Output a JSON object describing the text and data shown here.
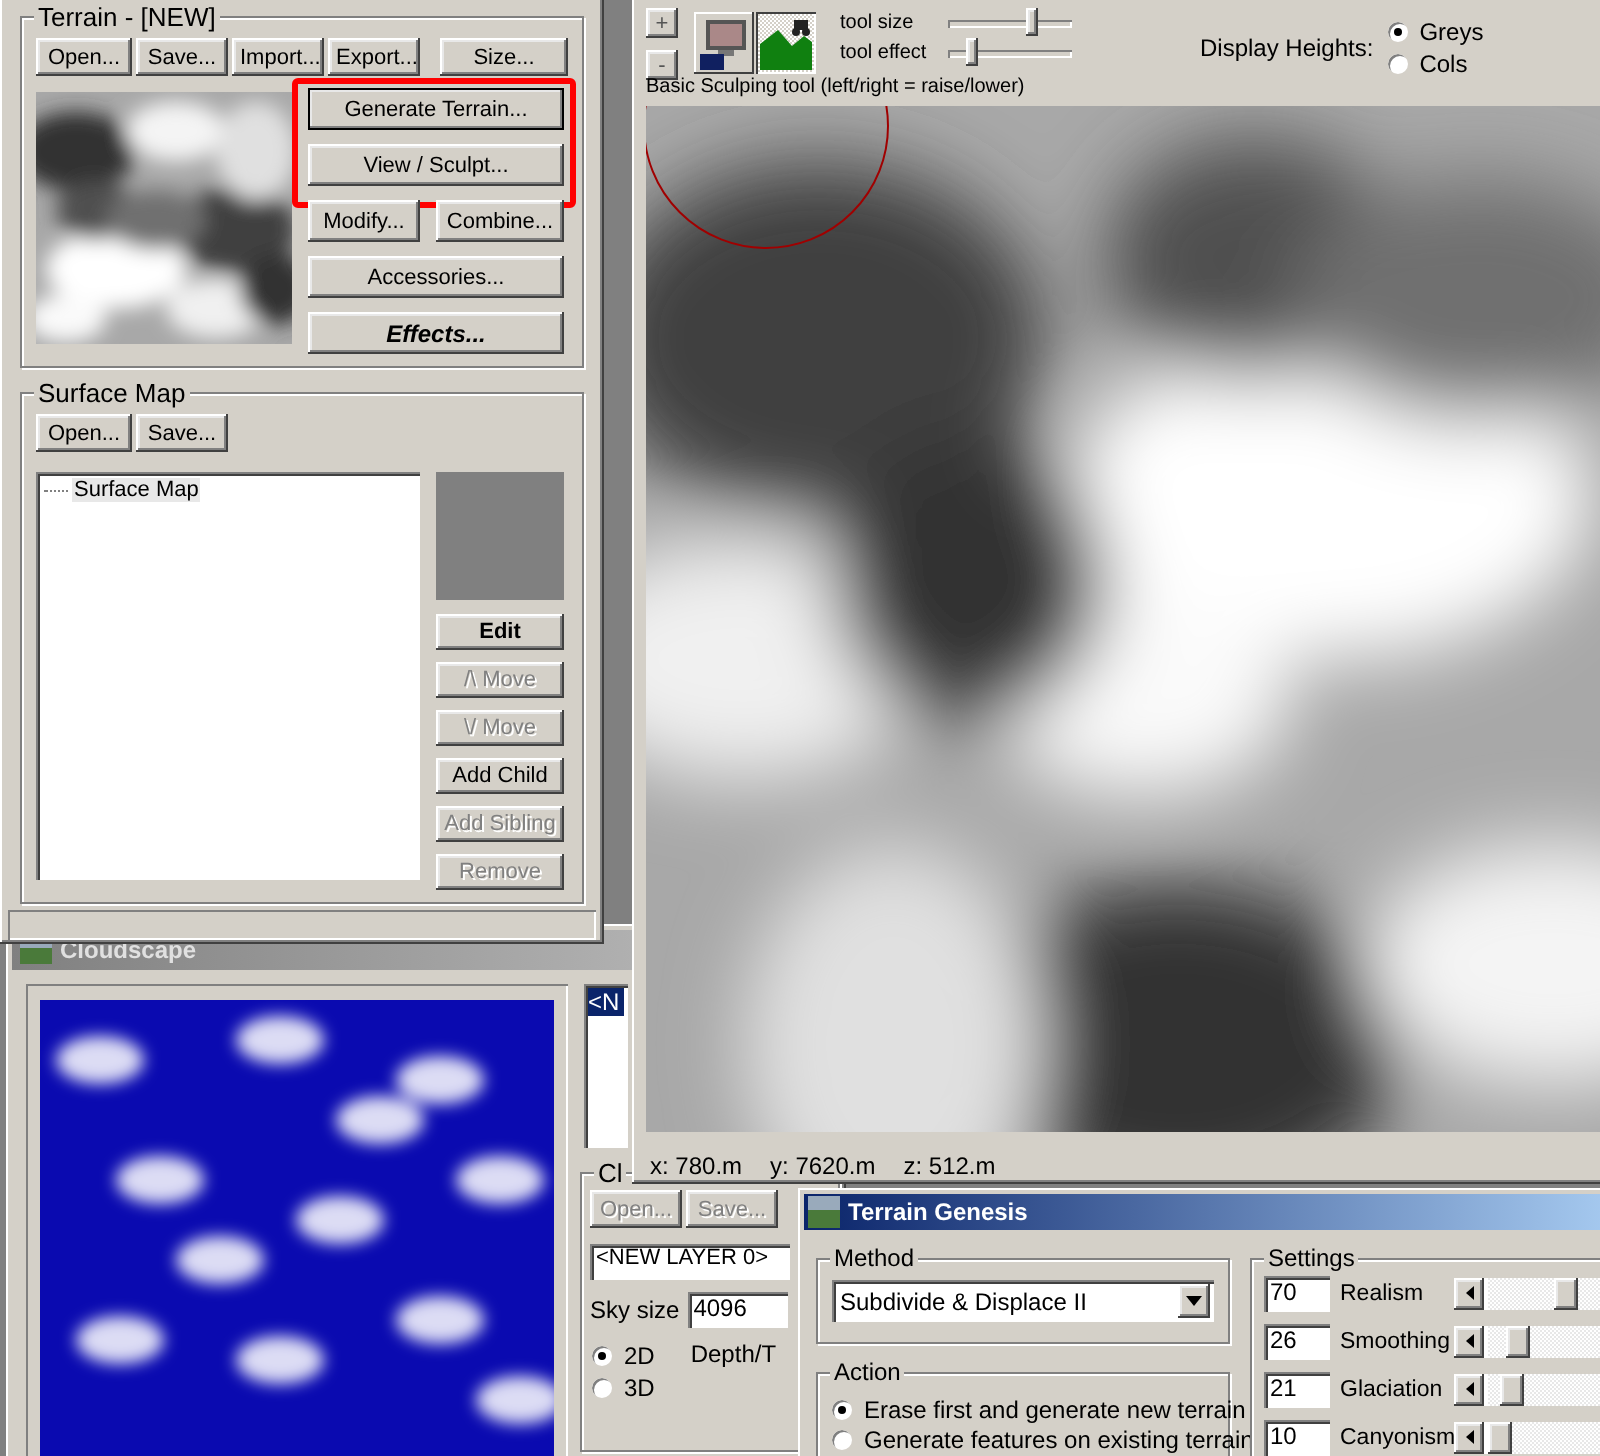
{
  "terrain_window": {
    "group_title": "Terrain - [NEW]",
    "file_buttons": [
      "Open...",
      "Save...",
      "Import...",
      "Export..."
    ],
    "size_button": "Size...",
    "highlighted_buttons": [
      {
        "label": "Generate Terrain...",
        "default": true
      },
      {
        "label": "View / Sculpt...",
        "default": false
      }
    ],
    "modify_buttons": [
      "Modify...",
      "Combine..."
    ],
    "accessories_button": "Accessories...",
    "effects_button": "Effects..."
  },
  "surface_map": {
    "title": "Surface Map",
    "file_buttons": [
      "Open...",
      "Save..."
    ],
    "tree": [
      {
        "label": "Surface Map",
        "selected": false
      }
    ],
    "buttons": [
      {
        "label": "Edit",
        "disabled": false,
        "bold": true
      },
      {
        "label": "/\\ Move",
        "disabled": true,
        "bold": false
      },
      {
        "label": "\\/ Move",
        "disabled": true,
        "bold": false
      },
      {
        "label": "Add Child",
        "disabled": false,
        "bold": false
      },
      {
        "label": "Add Sibling",
        "disabled": true,
        "bold": false
      },
      {
        "label": "Remove",
        "disabled": true,
        "bold": false
      }
    ]
  },
  "cloudscape": {
    "title": "Cloudscape",
    "layers": [
      {
        "label": "<N",
        "selected": true
      }
    ],
    "group_title": "Cl",
    "buttons": [
      {
        "label": "Open...",
        "disabled": true
      },
      {
        "label": "Save...",
        "disabled": true
      }
    ],
    "layer_name": "<NEW LAYER 0>",
    "sky_size_label": "Sky size",
    "sky_size": "4096",
    "modes": [
      {
        "label": "2D",
        "selected": true
      },
      {
        "label": "3D",
        "selected": false
      }
    ],
    "depth_label": "Depth/T"
  },
  "sculpt_window": {
    "zoom_buttons": [
      "+",
      "-"
    ],
    "tools": [
      {
        "kind": "monitor",
        "selected": false
      },
      {
        "kind": "terrain",
        "selected": true
      }
    ],
    "sliders": [
      {
        "label": "tool size",
        "level": 0.68
      },
      {
        "label": "tool effect",
        "level": 0.2
      }
    ],
    "display_heights": {
      "label": "Display Heights:",
      "options": [
        {
          "label": "Greys",
          "selected": true
        },
        {
          "label": "Cols",
          "selected": false
        }
      ]
    },
    "tool_hint": "Basic Sculping tool (left/right = raise/lower)",
    "coordinates": [
      "x: 780.m",
      "y: 7620.m",
      "z: 512.m"
    ]
  },
  "terrain_genesis": {
    "title": "Terrain Genesis",
    "method_title": "Method",
    "method": "Subdivide & Displace II",
    "action_title": "Action",
    "actions": [
      {
        "label": "Erase first and generate new terrain",
        "selected": true
      },
      {
        "label": "Generate features on existing terrain",
        "selected": false
      }
    ],
    "settings_title": "Settings",
    "settings": [
      {
        "value": "70",
        "label": "Realism",
        "level": 0.7
      },
      {
        "value": "26",
        "label": "Smoothing",
        "level": 0.26
      },
      {
        "value": "21",
        "label": "Glaciation",
        "level": 0.21
      },
      {
        "value": "10",
        "label": "Canyonism",
        "level": 0.1
      }
    ]
  }
}
